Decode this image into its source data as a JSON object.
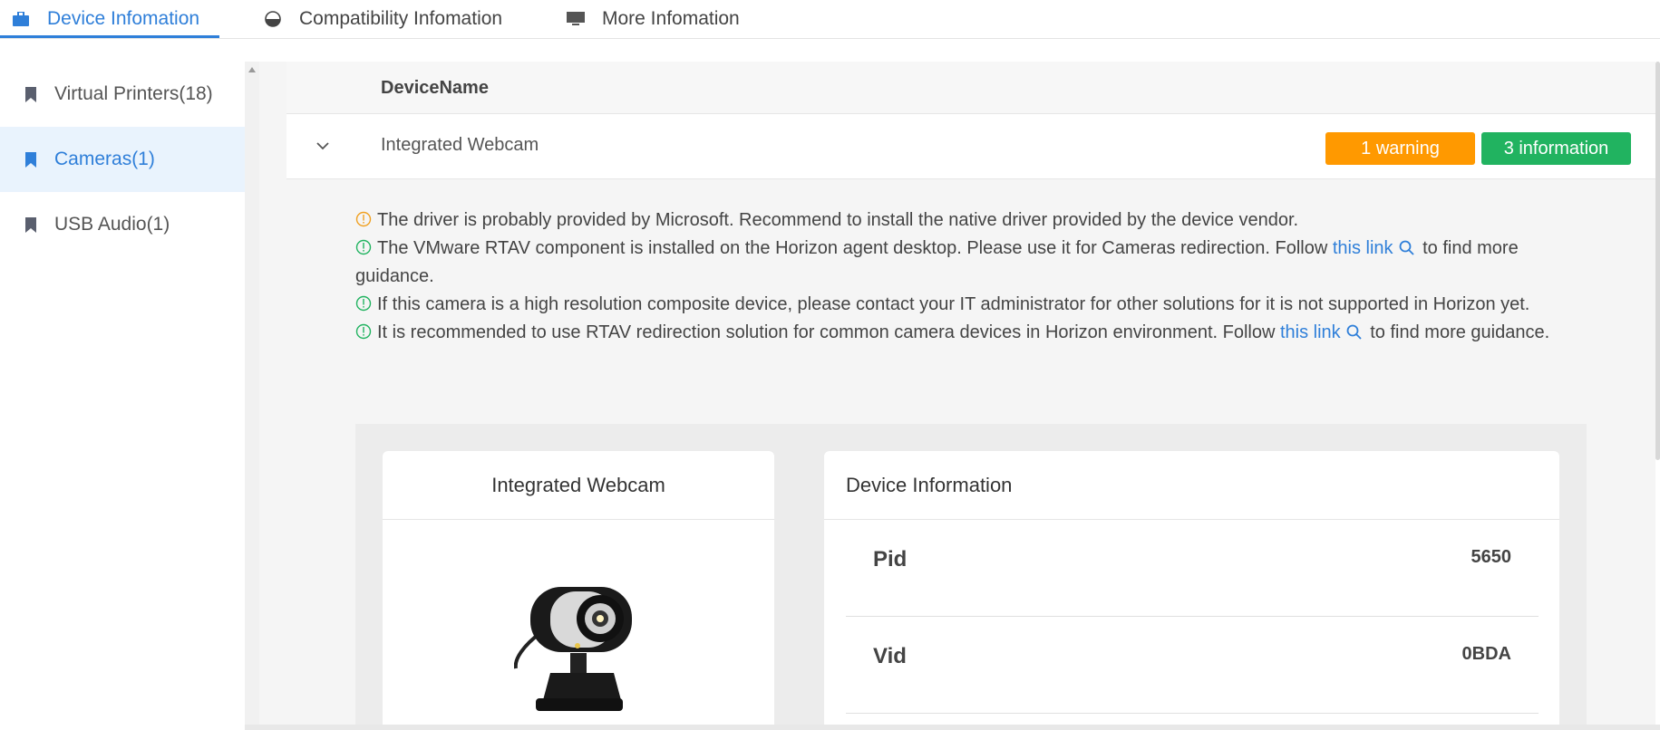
{
  "tabs": [
    {
      "label": "Device Infomation",
      "icon": "briefcase-icon",
      "active": true
    },
    {
      "label": "Compatibility Infomation",
      "icon": "half-circle-icon",
      "active": false
    },
    {
      "label": "More Infomation",
      "icon": "monitor-icon",
      "active": false
    }
  ],
  "sidebar": {
    "items": [
      {
        "label": "Virtual Printers(18)",
        "active": false
      },
      {
        "label": "Cameras(1)",
        "active": true
      },
      {
        "label": "USB Audio(1)",
        "active": false
      }
    ]
  },
  "table": {
    "column_header": "DeviceName",
    "row": {
      "device_name": "Integrated Webcam",
      "warning_badge": "1 warning",
      "info_badge": "3 information"
    }
  },
  "messages": [
    {
      "type": "warning",
      "text": "The driver is probably provided by Microsoft. Recommend to install the native driver provided by the device vendor."
    },
    {
      "type": "info",
      "text_before": "The VMware RTAV component is installed on the Horizon agent desktop. Please use it for Cameras redirection. Follow ",
      "link": "this link",
      "text_after": " to find more guidance."
    },
    {
      "type": "info",
      "text": "If this camera is a high resolution composite device, please contact your IT administrator for other solutions for it is not supported in Horizon yet."
    },
    {
      "type": "info",
      "text_before": "It is recommended to use RTAV redirection solution for common camera devices in Horizon environment. Follow ",
      "link": "this link",
      "text_after": " to find more guidance."
    }
  ],
  "detail": {
    "image_card_title": "Integrated Webcam",
    "info_card_title": "Device Information",
    "fields": [
      {
        "key": "Pid",
        "value": "5650"
      },
      {
        "key": "Vid",
        "value": "0BDA"
      }
    ]
  },
  "colors": {
    "accent": "#2f7fd9",
    "warning": "#ff9900",
    "info": "#21b360"
  }
}
